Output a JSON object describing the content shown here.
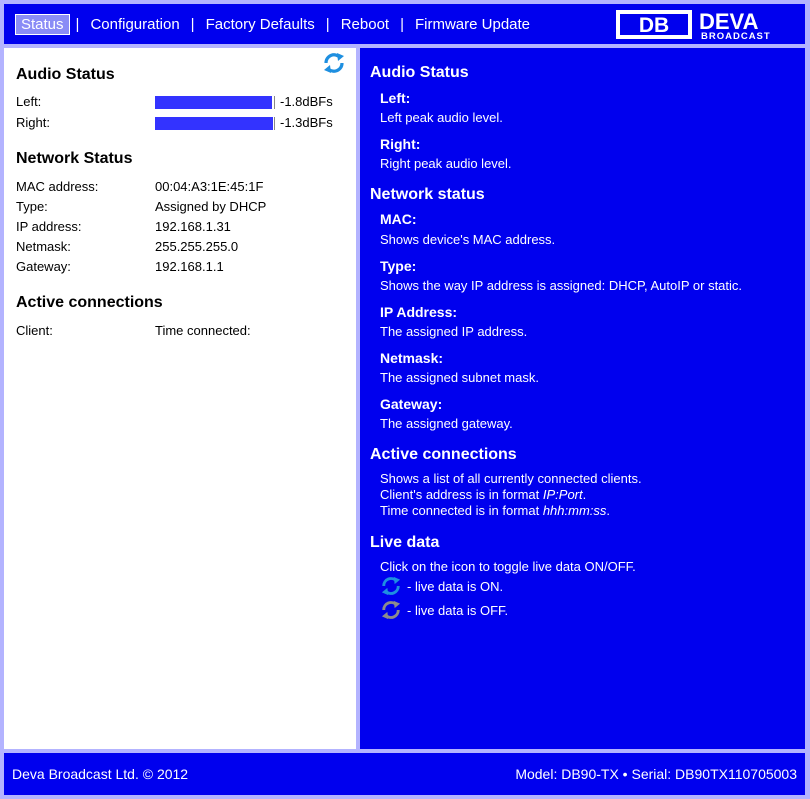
{
  "nav": {
    "items": [
      "Status",
      "Configuration",
      "Factory Defaults",
      "Reboot",
      "Firmware Update"
    ],
    "separator": "|",
    "active_index": 0
  },
  "logo": {
    "brand": "DEVA",
    "sub": "BROADCAST",
    "mark": "DB"
  },
  "left": {
    "audio": {
      "title": "Audio Status",
      "left_label": "Left:",
      "left_value": "-1.8dBFs",
      "left_level": 0.98,
      "right_label": "Right:",
      "right_value": "-1.3dBFs",
      "right_level": 0.99
    },
    "network": {
      "title": "Network Status",
      "rows": [
        {
          "label": "MAC address:",
          "value": "00:04:A3:1E:45:1F"
        },
        {
          "label": "Type:",
          "value": "Assigned by DHCP"
        },
        {
          "label": "IP address:",
          "value": "192.168.1.31"
        },
        {
          "label": "Netmask:",
          "value": "255.255.255.0"
        },
        {
          "label": "Gateway:",
          "value": "192.168.1.1"
        }
      ]
    },
    "connections": {
      "title": "Active connections",
      "col_client": "Client:",
      "col_time": "Time connected:"
    }
  },
  "help": {
    "audio_title": "Audio Status",
    "left_title": "Left:",
    "left_text": "Left peak audio level.",
    "right_title": "Right:",
    "right_text": "Right peak audio level.",
    "network_title": "Network status",
    "mac_title": "MAC:",
    "mac_text": "Shows device's MAC address.",
    "type_title": "Type:",
    "type_text": "Shows the way IP address is assigned: DHCP, AutoIP or static.",
    "ip_title": "IP Address:",
    "ip_text": "The assigned IP address.",
    "netmask_title": "Netmask:",
    "netmask_text": "The assigned subnet mask.",
    "gateway_title": "Gateway:",
    "gateway_text": "The assigned gateway.",
    "conn_title": "Active connections",
    "conn_line1": "Shows a list of all currently connected clients.",
    "conn_line2_prefix": "Client's address is in format ",
    "conn_line2_fmt": "IP:Port",
    "conn_line2_suffix": ".",
    "conn_line3_prefix": "Time connected is in format ",
    "conn_line3_fmt": "hhh:mm:ss",
    "conn_line3_suffix": ".",
    "live_title": "Live data",
    "live_text": "Click on the icon to toggle live data ON/OFF.",
    "live_on": " - live data is ON.",
    "live_off": " - live data is OFF."
  },
  "footer": {
    "copyright": "Deva Broadcast Ltd. © 2012",
    "model": "Model: DB90-TX • Serial: DB90TX110705003"
  },
  "colors": {
    "panel_blue": "#0000ee",
    "meter_fill": "#3333ff",
    "refresh_on": "#1e8fe0",
    "refresh_off": "#8c8c8c"
  },
  "icons": {
    "live_toggle": "refresh-icon"
  }
}
